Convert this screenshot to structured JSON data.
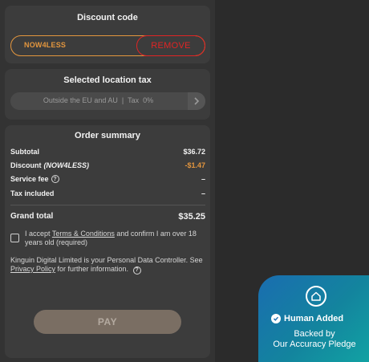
{
  "discount": {
    "title": "Discount code",
    "code": "NOW4LESS",
    "remove_label": "REMOVE"
  },
  "location_tax": {
    "title": "Selected location tax",
    "selected": "Outside the EU and AU  |  Tax  0%"
  },
  "order_summary": {
    "title": "Order summary",
    "subtotal_label": "Subtotal",
    "subtotal_value": "$36.72",
    "discount_label": "Discount",
    "discount_code": "(NOW4LESS)",
    "discount_value": "-$1.47",
    "service_fee_label": "Service fee",
    "service_fee_value": "–",
    "tax_included_label": "Tax included",
    "tax_included_value": "–",
    "grand_total_label": "Grand total",
    "grand_total_value": "$35.25",
    "accept_pre": "I accept ",
    "accept_link": "Terms & Conditions",
    "accept_post": " and confirm I am over 18 years old (required)",
    "data_pre": "Kinguin Digital Limited is your Personal Data Controller. See ",
    "data_link": "Privacy Policy",
    "data_post": " for further information.",
    "pay_label": "PAY"
  },
  "badge": {
    "title": "Human Added",
    "line1": "Backed by",
    "line2": "Our Accuracy Pledge"
  },
  "colors": {
    "accent": "#e3963e",
    "danger": "#e02424",
    "badge_start": "#1a6db0",
    "badge_end": "#12a3a3"
  },
  "icons": {
    "help": "question-circle-icon",
    "tax_arrow": "chevron-right-icon",
    "badge_logo": "house-shield-icon",
    "verified": "check-circle-icon"
  }
}
